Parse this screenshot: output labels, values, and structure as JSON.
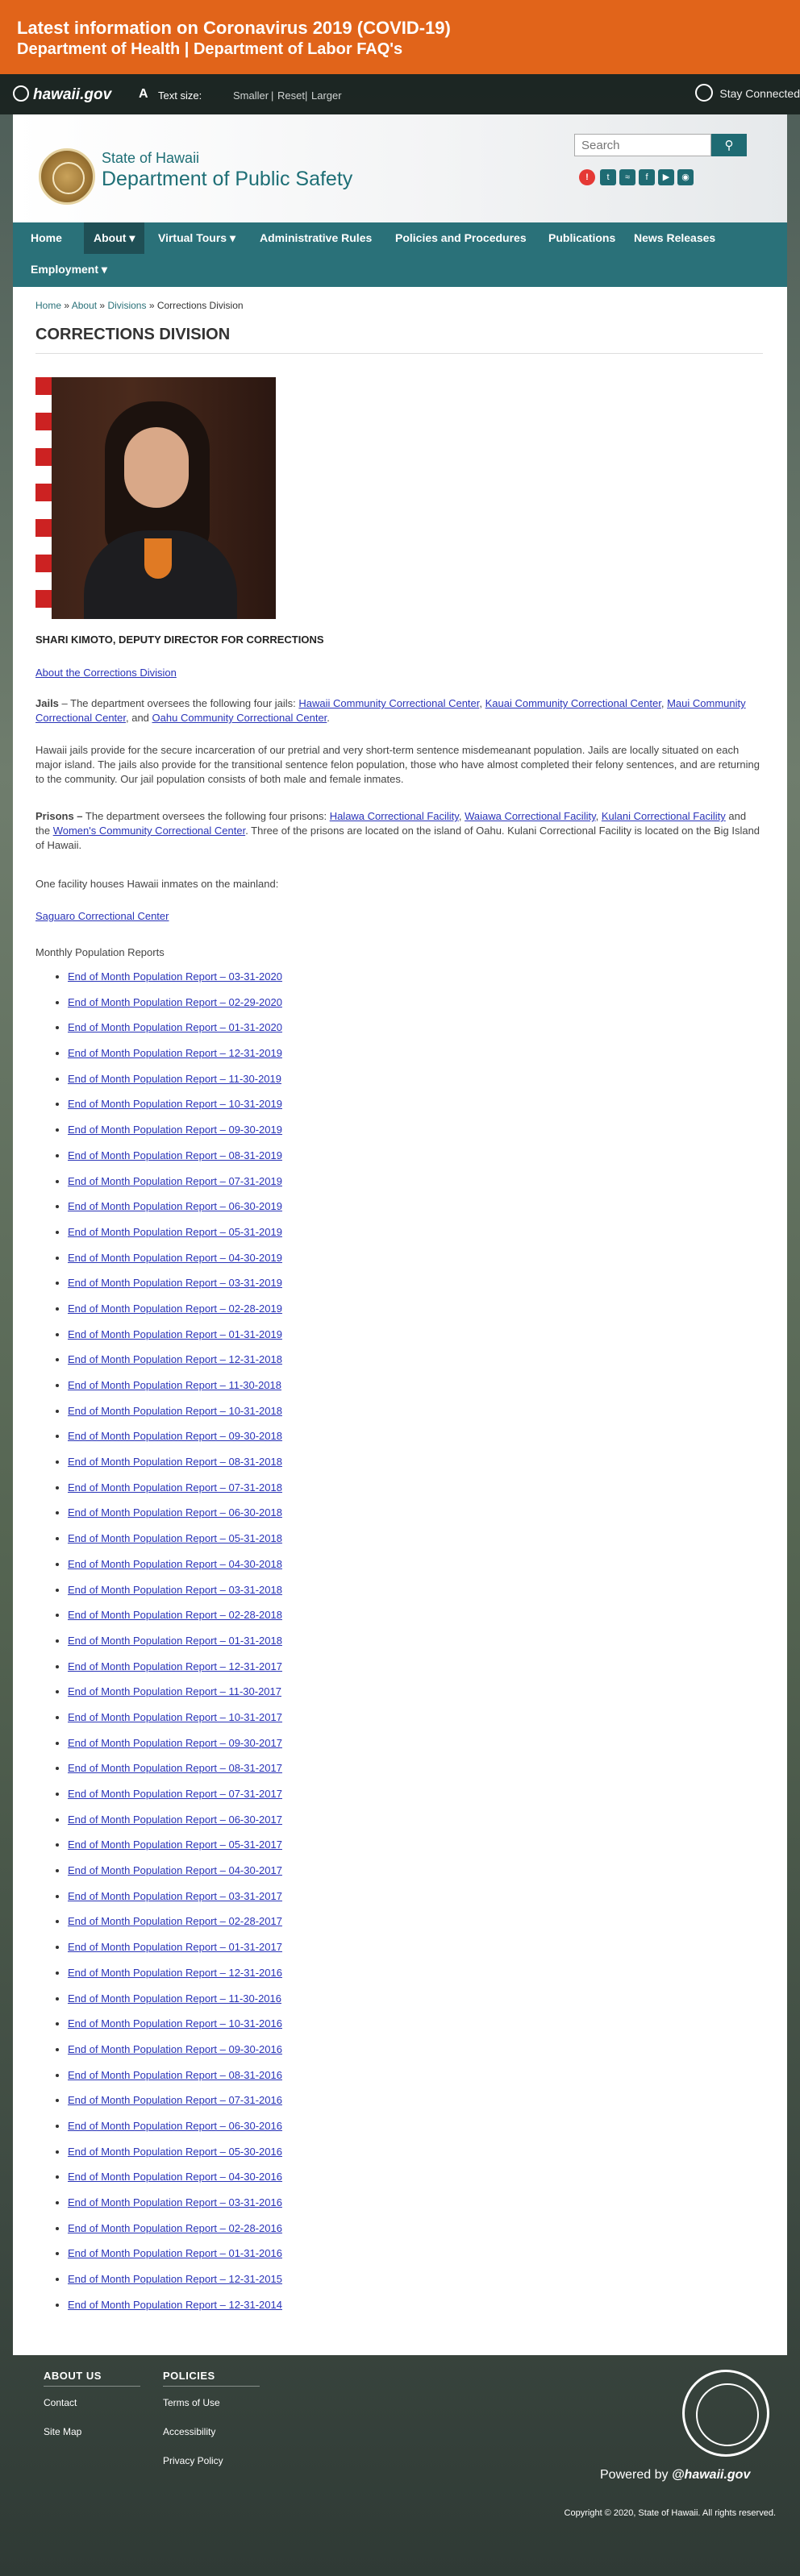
{
  "alert": {
    "line1": "Latest information on Coronavirus 2019 (COVID-19)",
    "line2": "Department of Health | Department of Labor FAQ's"
  },
  "topbar": {
    "logo": "hawaii.gov",
    "text_size_label": "Text size:",
    "smaller": "Smaller",
    "reset": "Reset",
    "larger": "Larger",
    "sep": "|",
    "stay_connected": "Stay Connected"
  },
  "header": {
    "state": "State of Hawaii",
    "department": "Department of Public Safety",
    "search_placeholder": "Search"
  },
  "nav": [
    {
      "label": "Home"
    },
    {
      "label": "About",
      "dropdown": true,
      "active": true
    },
    {
      "label": "Virtual Tours",
      "dropdown": true
    },
    {
      "label": "Administrative Rules"
    },
    {
      "label": "Policies and Procedures"
    },
    {
      "label": "Publications"
    },
    {
      "label": "News Releases"
    },
    {
      "label": "Employment",
      "dropdown": true
    }
  ],
  "breadcrumb": {
    "home": "Home",
    "about": "About",
    "divisions": "Divisions",
    "current": "Corrections Division",
    "sep": "»"
  },
  "page_title": "CORRECTIONS DIVISION",
  "caption": "SHARI KIMOTO, DEPUTY DIRECTOR FOR CORRECTIONS",
  "about_link": "About the Corrections Division",
  "jails": {
    "label": "Jails",
    "intro": " – The department oversees the following four jails: ",
    "links": [
      "Hawaii Community Correctional Center",
      "Kauai Community Correctional Center",
      "Maui Community Correctional Center",
      "Oahu Community Correctional Center"
    ],
    "and": ", and ",
    "comma": ", ",
    "end": "."
  },
  "jails_para": "Hawaii jails provide for the secure incarceration of our pretrial and very short-term sentence misdemeanant population. Jails are locally situated on each major island. The jails also provide for the transitional sentence felon population, those who have almost completed their felony sentences, and are returning to the community. Our jail population consists of both male and female inmates.",
  "prisons": {
    "label": "Prisons –",
    "intro": " The department oversees the following four prisons: ",
    "links": [
      "Halawa Correctional Facility",
      "Waiawa Correctional Facility",
      "Kulani Correctional Facility",
      "Women's Community Correctional Center"
    ],
    "comma": ", ",
    "and": " and the ",
    "tail": ".  Three of the prisons are located on the island of Oahu.  Kulani Correctional Facility is located on the Big Island of Hawaii."
  },
  "mainland_text": "One facility houses Hawaii inmates on the mainland:",
  "mainland_link": "Saguaro Correctional Center",
  "reports_title": "Monthly Population Reports",
  "reports": [
    "End of Month Population Report – 03-31-2020",
    "End of Month Population Report – 02-29-2020",
    "End of Month Population Report – 01-31-2020",
    "End of Month Population Report – 12-31-2019",
    "End of Month Population Report – 11-30-2019",
    "End of Month Population Report – 10-31-2019",
    "End of Month Population Report – 09-30-2019",
    "End of Month Population Report – 08-31-2019",
    "End of Month Population Report – 07-31-2019",
    "End of Month Population Report – 06-30-2019",
    "End of Month Population Report – 05-31-2019",
    "End of Month Population Report – 04-30-2019",
    "End of Month Population Report – 03-31-2019",
    "End of Month Population Report – 02-28-2019",
    "End of Month Population Report – 01-31-2019",
    "End of Month Population Report – 12-31-2018",
    "End of Month Population Report – 11-30-2018",
    "End of Month Population Report – 10-31-2018",
    "End of Month Population Report – 09-30-2018",
    "End of Month Population Report – 08-31-2018",
    "End of Month Population Report – 07-31-2018",
    "End of Month Population Report – 06-30-2018",
    "End of Month Population Report – 05-31-2018",
    "End of Month Population Report – 04-30-2018",
    "End of Month Population Report – 03-31-2018",
    "End of Month Population Report – 02-28-2018",
    "End of Month Population Report – 01-31-2018",
    "End of Month Population Report – 12-31-2017",
    "End of Month Population Report – 11-30-2017",
    "End of Month Population Report – 10-31-2017",
    "End of Month Population Report – 09-30-2017",
    "End of Month Population Report – 08-31-2017",
    "End of Month Population Report – 07-31-2017",
    "End of Month Population Report – 06-30-2017",
    "End of Month Population Report – 05-31-2017",
    "End of Month Population Report – 04-30-2017",
    "End of Month Population Report – 03-31-2017",
    "End of Month Population Report – 02-28-2017",
    "End of Month Population Report – 01-31-2017",
    "End of Month Population Report – 12-31-2016",
    "End of Month Population Report – 11-30-2016",
    "End of Month Population Report – 10-31-2016",
    "End of Month Population Report – 09-30-2016",
    "End of Month Population Report – 08-31-2016",
    "End of Month Population Report – 07-31-2016",
    "End of Month Population Report – 06-30-2016",
    "End of Month Population Report – 05-30-2016",
    "End of Month Population Report – 04-30-2016",
    "End of Month Population Report – 03-31-2016",
    "End of Month Population Report – 02-28-2016",
    "End of Month Population Report – 01-31-2016",
    "End of Month Population Report – 12-31-2015",
    "End of Month Population Report – 12-31-2014"
  ],
  "footer": {
    "about_heading": "ABOUT US",
    "about_links": [
      "Contact",
      "Site Map"
    ],
    "policies_heading": "POLICIES",
    "policies_links": [
      "Terms of Use",
      "Accessibility",
      "Privacy Policy"
    ],
    "powered_by": "Powered by",
    "powered_brand": "@hawaii.gov",
    "copyright": "Copyright © 2020, State of Hawaii. All rights reserved."
  },
  "colors": {
    "alert_bg": "#e1641a",
    "nav_bg": "#2a7179",
    "link": "#2a34b8"
  }
}
